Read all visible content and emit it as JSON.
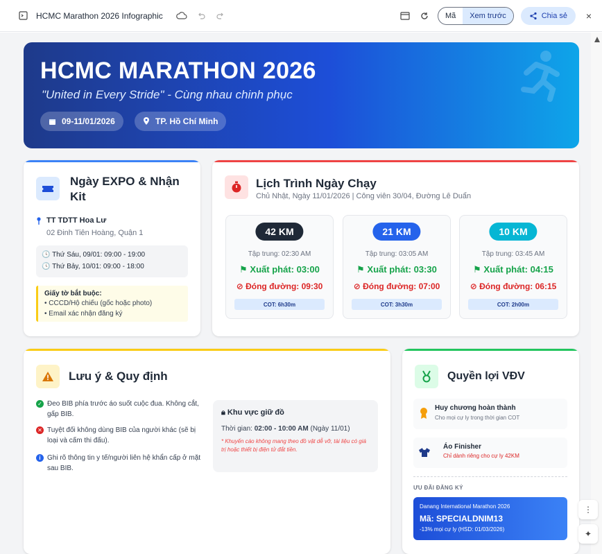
{
  "topbar": {
    "doc_title": "HCMC Marathon 2026 Infographic",
    "code_label": "Mã",
    "preview_label": "Xem trước",
    "share_label": "Chia sẻ",
    "close_label": "×"
  },
  "hero": {
    "title": "HCMC MARATHON 2026",
    "subtitle": "\"United in Every Stride\" - Cùng nhau chinh phục",
    "date": "09-11/01/2026",
    "location": "TP. Hồ Chí Minh"
  },
  "expo": {
    "title_line1": "Ngày EXPO & Nhận",
    "title_line2": "Kit",
    "venue": "TT TDTT Hoa Lư",
    "address": "02 Đinh Tiên Hoàng, Quận 1",
    "schedule": [
      "Thứ Sáu, 09/01: 09:00 - 19:00",
      "Thứ Bảy, 10/01: 09:00 - 18:00"
    ],
    "docs_title": "Giấy tờ bắt buộc:",
    "docs": [
      "CCCD/Hộ chiếu (gốc hoặc photo)",
      "Email xác nhận đăng ký"
    ]
  },
  "raceday": {
    "title": "Lịch Trình Ngày Chạy",
    "subtitle": "Chủ Nhật, Ngày 11/01/2026 | Công viên 30/04, Đường Lê Duẩn",
    "races": [
      {
        "km": "42 KM",
        "gather": "Tập trung: 02:30 AM",
        "start": "Xuất phát: 03:00",
        "close": "Đóng đường: 09:30",
        "cot": "COT: 6h30m",
        "color": "#1f2937"
      },
      {
        "km": "21 KM",
        "gather": "Tập trung: 03:05 AM",
        "start": "Xuất phát: 03:30",
        "close": "Đóng đường: 07:00",
        "cot": "COT: 3h30m",
        "color": "#2563eb"
      },
      {
        "km": "10 KM",
        "gather": "Tập trung: 03:45 AM",
        "start": "Xuất phát: 04:15",
        "close": "Đóng đường: 06:15",
        "cot": "COT: 2h00m",
        "color": "#06b6d4"
      }
    ]
  },
  "rules": {
    "title": "Lưu ý & Quy định",
    "items": [
      {
        "text": "Đeo BIB phía trước áo suốt cuộc đua. Không cắt, gấp BIB.",
        "color": "#16a34a"
      },
      {
        "text": "Tuyệt đối không dùng BIB của người khác (sẽ bị loại và cấm thi đấu).",
        "color": "#dc2626"
      },
      {
        "text": "Ghi rõ thông tin y tế/người liên hệ khẩn cấp ở mặt sau BIB.",
        "color": "#2563eb"
      }
    ],
    "storage_title": "Khu vực giữ đồ",
    "storage_time_label": "Thời gian:",
    "storage_time": "02:00 - 10:00 AM",
    "storage_date": "(Ngày 11/01)",
    "storage_note": "* Khuyến cáo không mang theo đồ vật dễ vỡ, tài liệu có giá trị hoặc thiết bị điện tử đắt tiền."
  },
  "benefits": {
    "title": "Quyền lợi VĐV",
    "items": [
      {
        "title": "Huy chương hoàn thành",
        "desc": "Cho mọi cự ly trong thời gian COT"
      },
      {
        "title": "Áo Finisher",
        "desc": "Chỉ dành riêng cho cự ly 42KM"
      }
    ],
    "promo_label": "ƯU ĐÃI ĐĂNG KÝ",
    "promo_event": "Danang International Marathon 2026",
    "promo_code": "Mã: SPECIALDNIM13",
    "promo_desc": "-13% mọi cự ly (HSD: 01/03/2026)"
  }
}
